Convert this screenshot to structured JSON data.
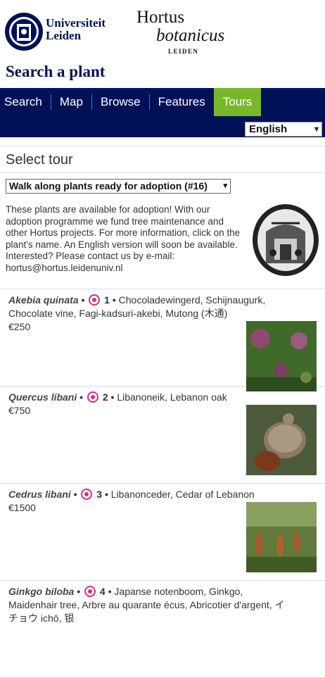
{
  "header": {
    "university_line1": "Universiteit",
    "university_line2": "Leiden",
    "hortus_line1": "Hortus",
    "hortus_line2": "botanicus",
    "hortus_line3": "LEIDEN",
    "site_title": "Search a plant"
  },
  "nav": {
    "items": [
      {
        "label": "Search"
      },
      {
        "label": "Map"
      },
      {
        "label": "Browse"
      },
      {
        "label": "Features"
      },
      {
        "label": "Tours",
        "active": true
      }
    ],
    "language": "English"
  },
  "panel": {
    "title": "Select tour",
    "tour_selected": "Walk along plants ready for adoption (#16)",
    "intro": "These plants are available for adoption! With our adoption programme we fund tree maintenance and other Hortus projects. For more information, click on the plant's name. An English version will soon be available. Interested? Please contact us by e-mail: hortus@hortus.leidenuniv.nl"
  },
  "plants": [
    {
      "scientific": "Akebia quinata",
      "number": "1",
      "common": "Chocoladewingerd, Schijnaugurk, Chocolate vine, Fagi-kadsuri-akebi, Mutong (木通)",
      "price": "€250"
    },
    {
      "scientific": "Quercus libani",
      "number": "2",
      "common": "Libanoneik, Lebanon oak",
      "price": "€750"
    },
    {
      "scientific": "Cedrus libani",
      "number": "3",
      "common": "Libanonceder, Cedar of Lebanon",
      "price": "€1500"
    },
    {
      "scientific": "Ginkgo biloba",
      "number": "4",
      "common": "Japanse notenboom, Ginkgo, Maidenhair tree, Arbre au quarante écus, Abricotier d'argent, イチョウ ichō, 银"
    }
  ],
  "colors": {
    "brand_navy": "#001158",
    "active_tab": "#77b82a",
    "marker": "#d12e86"
  }
}
